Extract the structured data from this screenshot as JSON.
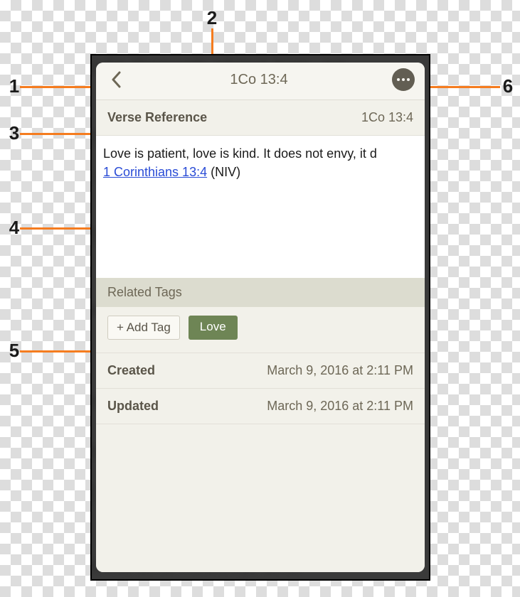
{
  "callouts": {
    "n1": "1",
    "n2": "2",
    "n3": "3",
    "n4": "4",
    "n5": "5",
    "n6": "6"
  },
  "header": {
    "title": "1Co 13:4"
  },
  "verse_reference": {
    "label": "Verse Reference",
    "value": "1Co 13:4"
  },
  "note": {
    "text_prefix": "Love is patient, love is kind. It does not envy, it d",
    "link_text": "1 Corinthians 13:4",
    "text_suffix": " (NIV)"
  },
  "related_tags": {
    "heading": "Related Tags",
    "add_tag_label": "+ Add Tag",
    "tags": [
      "Love"
    ]
  },
  "created": {
    "label": "Created",
    "value": "March 9, 2016 at 2:11 PM"
  },
  "updated": {
    "label": "Updated",
    "value": "March 9, 2016 at 2:11 PM"
  },
  "icons": {
    "back": "chevron-left-icon",
    "more": "more-icon"
  },
  "colors": {
    "accent": "#f57c1f",
    "tag": "#6e8555",
    "text_muted": "#6d6756"
  }
}
